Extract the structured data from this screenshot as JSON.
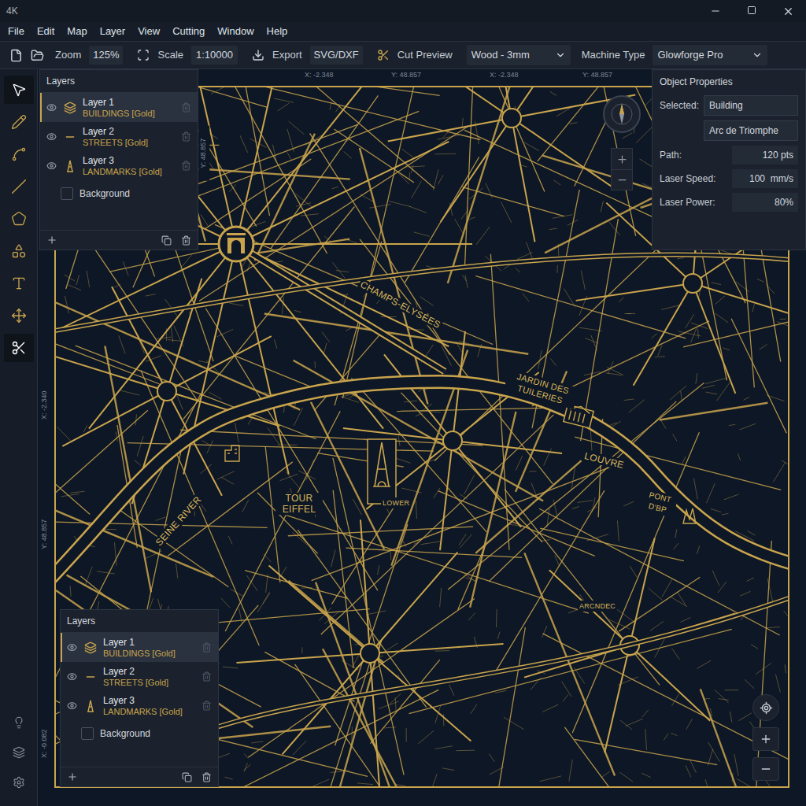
{
  "window": {
    "title": "4K"
  },
  "menu": [
    "File",
    "Edit",
    "Map",
    "Layer",
    "View",
    "Cutting",
    "Window",
    "Help"
  ],
  "toolbar": {
    "zoom_label": "Zoom",
    "zoom": "125%",
    "scale_label": "Scale",
    "scale": "1:10000",
    "export_label": "Export",
    "export_format": "SVG/DXF",
    "cut_preview": "Cut Preview",
    "material": "Wood - 3mm",
    "machine_label": "Machine Type",
    "machine": "Glowforge Pro"
  },
  "tools": [
    {
      "kind": "select",
      "selected": true
    },
    {
      "kind": "pen",
      "selected": false
    },
    {
      "kind": "node",
      "selected": false
    },
    {
      "kind": "line",
      "selected": false
    },
    {
      "kind": "polygon",
      "selected": false
    },
    {
      "kind": "shape",
      "selected": false
    },
    {
      "kind": "text",
      "selected": false
    },
    {
      "kind": "move",
      "selected": false
    },
    {
      "kind": "cut",
      "selected": true
    }
  ],
  "bottom_tools": [
    {
      "kind": "hint"
    },
    {
      "kind": "layers"
    },
    {
      "kind": "settings"
    }
  ],
  "layers_panel": {
    "title": "Layers",
    "background": "Background",
    "layers": [
      {
        "name": "Layer 1",
        "detail": "BUILDINGS [Gold]",
        "kind": "buildings",
        "visible": true,
        "selected": true
      },
      {
        "name": "Layer 2",
        "detail": "STREETS [Gold]",
        "kind": "streets",
        "visible": true,
        "selected": false
      },
      {
        "name": "Layer 3",
        "detail": "LANDMARKS [Gold]",
        "kind": "landmarks",
        "visible": true,
        "selected": false
      }
    ]
  },
  "layers_panel_2": {
    "title": "Layers",
    "background": "Background",
    "layers": [
      {
        "name": "Layer 1",
        "detail": "BUILDINGS [Gold]",
        "kind": "buildings",
        "visible": true,
        "selected": true
      },
      {
        "name": "Layer 2",
        "detail": "STREETS [Gold]",
        "kind": "streets",
        "visible": true,
        "selected": false
      },
      {
        "name": "Layer 3",
        "detail": "LANDMARKS [Gold]",
        "kind": "landmarks",
        "visible": true,
        "selected": false
      }
    ]
  },
  "properties": {
    "title": "Object Properties",
    "selected_label": "Selected:",
    "selected_type": "Building",
    "selected_name": "Arc de Triomphe",
    "fields": [
      {
        "label": "Path:",
        "value": "120 pts"
      },
      {
        "label": "Laser Speed:",
        "value": "100  mm/s"
      },
      {
        "label": "Laser Power:",
        "value": "80%"
      }
    ]
  },
  "rulers": {
    "top": [
      "X: -2.348",
      "Y: 48.857",
      "X: -2.348",
      "Y: 48.857"
    ],
    "left": [
      "Y: 48.857",
      "X: -2.340",
      "Y: 48.857",
      "X: -0.082"
    ]
  },
  "map": {
    "labels": [
      "CHAMPS-ELYSÉES",
      "JARDIN DES TUILERIES",
      "LOUVRE",
      "TOUR EIFFEL",
      "LOWER",
      "SEINE RIVER",
      "PONT D'BP",
      "ARCNDEC"
    ]
  }
}
